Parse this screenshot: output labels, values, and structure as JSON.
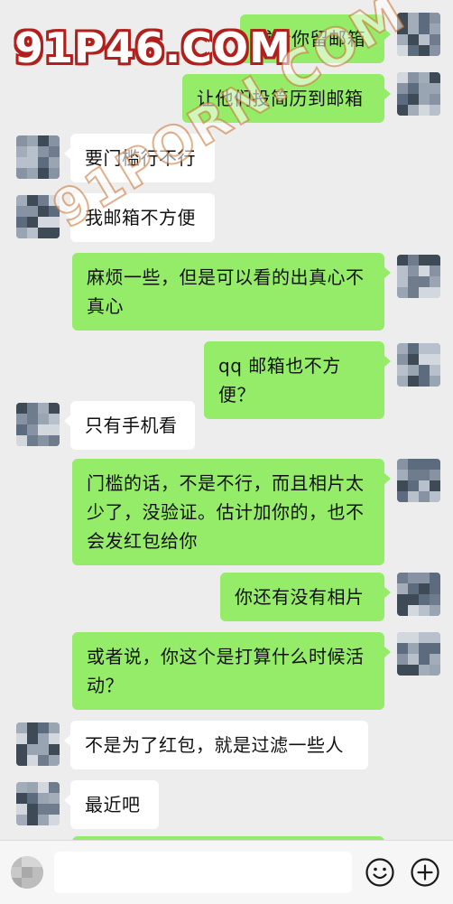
{
  "watermark": {
    "top_logo": "91P46.COM",
    "diagonal": "91PORN.COM"
  },
  "messages": [
    {
      "side": "me",
      "text": "或者你留邮箱"
    },
    {
      "side": "me",
      "text": "让他们投简历到邮箱"
    },
    {
      "side": "them",
      "text": "要门槛行不行"
    },
    {
      "side": "them",
      "text": "我邮箱不方便"
    },
    {
      "side": "me",
      "text": "麻烦一些，但是可以看的出真心不真心"
    },
    {
      "side": "me",
      "text": "qq 邮箱也不方便？"
    },
    {
      "side": "them",
      "text": "只有手机看"
    },
    {
      "side": "me",
      "text": "门槛的话，不是不行，而且相片太少了，没验证。估计加你的，也不会发红包给你"
    },
    {
      "side": "me",
      "text": "你还有没有相片"
    },
    {
      "side": "me",
      "text": "或者说，你这个是打算什么时候活动？"
    },
    {
      "side": "them",
      "text": "不是为了红包，就是过滤一些人"
    },
    {
      "side": "them",
      "text": "最近吧"
    }
  ],
  "input_bar": {
    "message_input_value": "",
    "emoji_icon": "emoji-icon",
    "plus_icon": "plus-icon"
  },
  "colors": {
    "background": "#ededed",
    "my_bubble": "#95ec69",
    "their_bubble": "#ffffff",
    "input_bar": "#f6f6f6"
  }
}
